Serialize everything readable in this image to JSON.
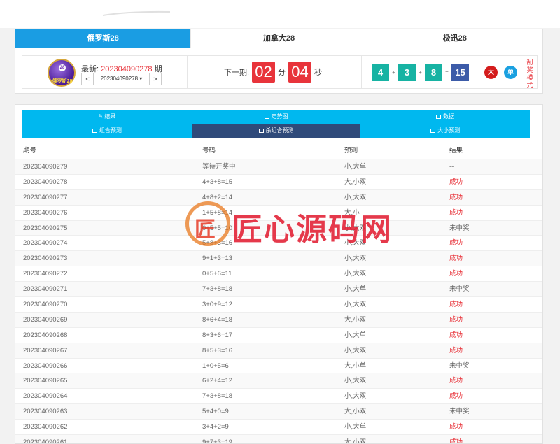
{
  "game_tabs": [
    {
      "label": "俄罗斯28",
      "active": true
    },
    {
      "label": "加拿大28",
      "active": false
    },
    {
      "label": "极迅28",
      "active": false
    }
  ],
  "status": {
    "logo_badge": "28",
    "logo_text": "俄罗斯28",
    "latest_label": "最新:",
    "latest_period": "202304090278",
    "period_suffix": "期",
    "period_prev": "<",
    "period_select": "202304090278",
    "period_next": ">",
    "next_label": "下一期:",
    "minutes": "02",
    "min_unit": "分",
    "seconds": "04",
    "sec_unit": "秒",
    "numbers": [
      "4",
      "3",
      "8"
    ],
    "plus": "+",
    "equals": "=",
    "sum": "15",
    "size": "大",
    "parity": "单",
    "mode_vertical": "刮奖模式"
  },
  "nav_row1": [
    {
      "label": "结果",
      "icon": "wrench-icon"
    },
    {
      "label": "走势图",
      "icon": "image-icon"
    },
    {
      "label": "数据",
      "icon": "image-icon"
    }
  ],
  "nav_row2": [
    {
      "label": "组合预测",
      "icon": "image-icon",
      "active": false
    },
    {
      "label": "杀组合预测",
      "icon": "image-icon",
      "active": true
    },
    {
      "label": "大小预测",
      "icon": "image-icon",
      "active": false
    }
  ],
  "table": {
    "headers": [
      "期号",
      "号码",
      "预测",
      "结果"
    ],
    "rows": [
      [
        "202304090279",
        "等待开奖中",
        "小,大单",
        "--"
      ],
      [
        "202304090278",
        "4+3+8=15",
        "大,小双",
        "成功"
      ],
      [
        "202304090277",
        "4+8+2=14",
        "小,大双",
        "成功"
      ],
      [
        "202304090276",
        "1+5+8=14",
        "大,小",
        "成功"
      ],
      [
        "202304090275",
        "0+5+5=10",
        "小,大双",
        "未中奖"
      ],
      [
        "202304090274",
        "5+8+3=16",
        "小,大双",
        "成功"
      ],
      [
        "202304090273",
        "9+1+3=13",
        "小,大双",
        "成功"
      ],
      [
        "202304090272",
        "0+5+6=11",
        "小,大双",
        "成功"
      ],
      [
        "202304090271",
        "7+3+8=18",
        "小,大单",
        "未中奖"
      ],
      [
        "202304090270",
        "3+0+9=12",
        "小,大双",
        "成功"
      ],
      [
        "202304090269",
        "8+6+4=18",
        "大,小双",
        "成功"
      ],
      [
        "202304090268",
        "8+3+6=17",
        "小,大单",
        "成功"
      ],
      [
        "202304090267",
        "8+5+3=16",
        "小,大双",
        "成功"
      ],
      [
        "202304090266",
        "1+0+5=6",
        "大,小单",
        "未中奖"
      ],
      [
        "202304090265",
        "6+2+4=12",
        "小,大双",
        "成功"
      ],
      [
        "202304090264",
        "7+3+8=18",
        "小,大双",
        "成功"
      ],
      [
        "202304090263",
        "5+4+0=9",
        "大,小双",
        "未中奖"
      ],
      [
        "202304090262",
        "3+4+2=9",
        "小,大单",
        "成功"
      ],
      [
        "202304090261",
        "9+7+3=19",
        "大,小双",
        "成功"
      ]
    ]
  },
  "watermark": {
    "mark": "匠",
    "text": "匠心源码网"
  },
  "colors": {
    "accent": "#1a9de3",
    "nav": "#00b8ef",
    "nav_active": "#2f4a7a",
    "red": "#e8343b",
    "teal": "#17b3a3"
  }
}
